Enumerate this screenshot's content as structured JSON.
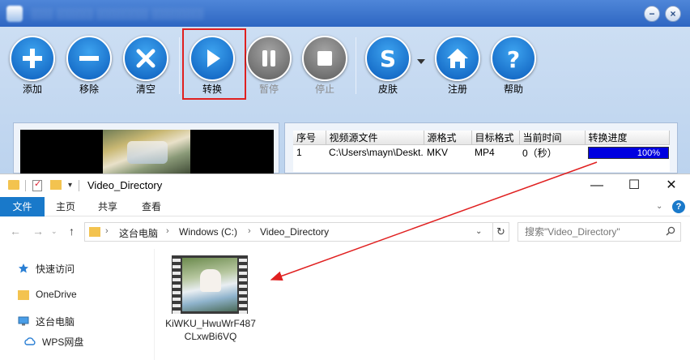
{
  "converter": {
    "title_obscured": true,
    "toolbar": {
      "add": "添加",
      "remove": "移除",
      "clear": "清空",
      "convert": "转换",
      "pause": "暂停",
      "stop": "停止",
      "skin": "皮肤",
      "register": "注册",
      "help": "帮助"
    },
    "table": {
      "headers": [
        "序号",
        "视频源文件",
        "源格式",
        "目标格式",
        "当前时间",
        "转换进度"
      ],
      "rows": [
        {
          "index": "1",
          "source": "C:\\Users\\mayn\\Deskt...",
          "src_format": "MKV",
          "dst_format": "MP4",
          "time": "0（秒）",
          "progress": "100%",
          "progress_value": 1.0
        }
      ]
    },
    "colors": {
      "accent": "#1a6fd0",
      "highlight": "#e02020",
      "progress": "#0000e0"
    }
  },
  "explorer": {
    "title": "Video_Directory",
    "ribbon": {
      "tabs": [
        "文件",
        "主页",
        "共享",
        "查看"
      ]
    },
    "address": {
      "crumbs": [
        "这台电脑",
        "Windows (C:)",
        "Video_Directory"
      ]
    },
    "search": {
      "placeholder": "搜索\"Video_Directory\""
    },
    "nav_pane": {
      "items": [
        "快速访问",
        "OneDrive",
        "这台电脑",
        "WPS网盘"
      ]
    },
    "file": {
      "name": "KiWKU_HwuWrF487CLxwBi6VQ"
    },
    "colors": {
      "file_tab": "#1979ca",
      "folder": "#f3c34f",
      "arrow": "#e02020"
    }
  }
}
